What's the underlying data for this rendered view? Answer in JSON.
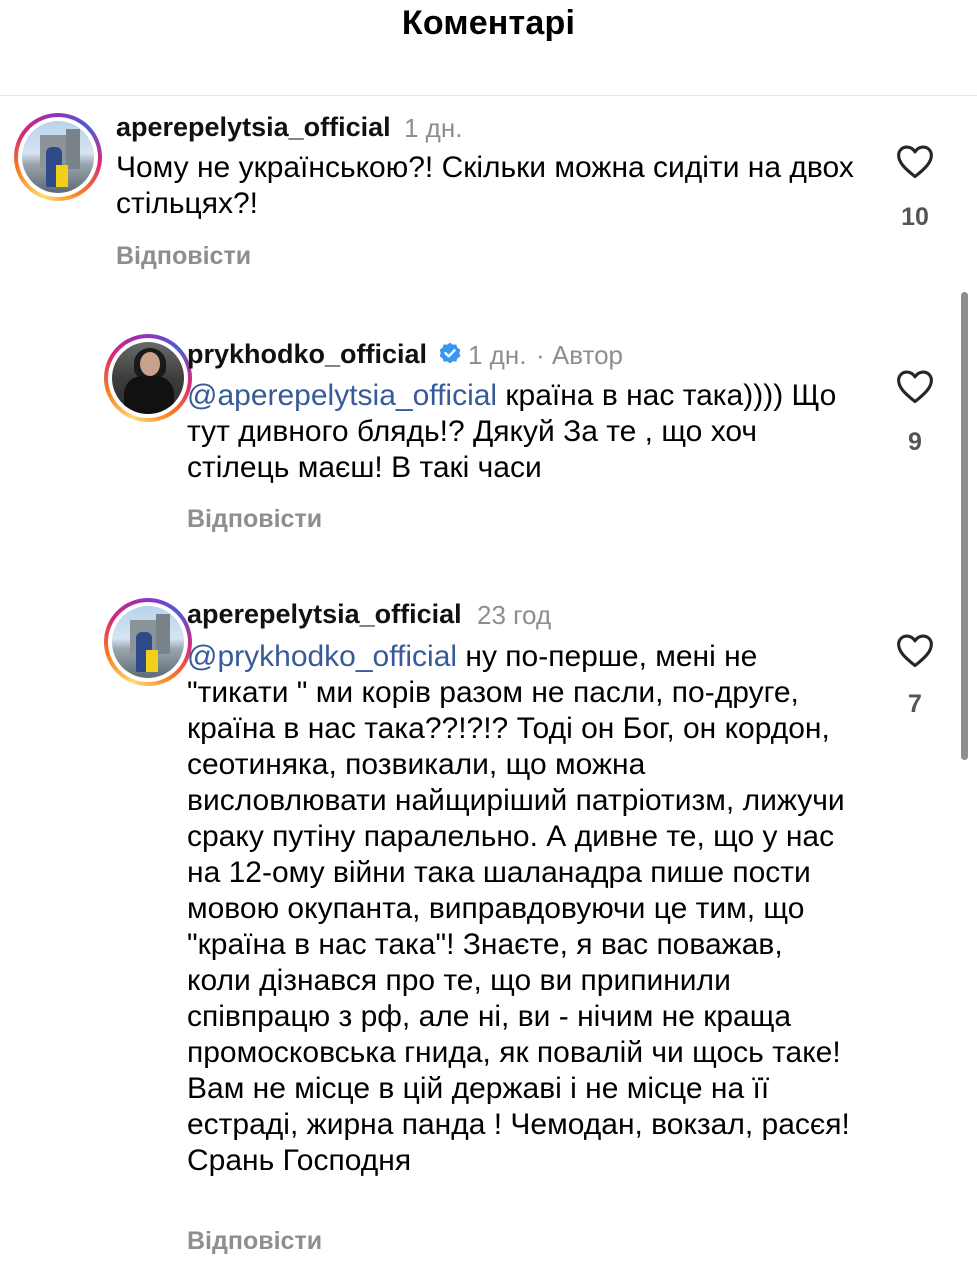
{
  "header": {
    "title": "Коментарі"
  },
  "comments": [
    {
      "username": "aperepelytsia_official",
      "time": "1 дн.",
      "text": "Чому не українською?! Скільки можна сидіти на двох стільцях?!",
      "likes": "10",
      "reply_label": "Відповісти"
    },
    {
      "username": "prykhodko_official",
      "time": "1 дн.",
      "author_label": "· Автор",
      "mention": "@aperepelytsia_official",
      "text": " країна в нас така)))) Що тут дивного блядь!? Дякуй За те , що хоч стілець маєш! В такі часи",
      "likes": "9",
      "reply_label": "Відповісти"
    },
    {
      "username": "aperepelytsia_official",
      "time": "23 год",
      "mention": "@prykhodko_official",
      "text": " ну по-перше, мені не \"тикати \" ми корів разом не пасли, по-друге, країна в нас така??!?!? Тоді он Бог, он кордон, сеотиняка, позвикали, що можна висловлювати найщиріший патріотизм, лижучи сраку путіну паралельно. А дивне те, що у нас на 12-ому війни така шаланадра пише пости мовою окупанта, виправдовуючи це тим, що \"країна в нас така\"! Знаєте, я вас поважав, коли дізнався про те, що ви припинили співпрацю з рф, але ні, ви - нічим не краща промосковська гнида, як повалій чи щось таке!  Вам не місце в цій державі і не місце на її естраді, жирна панда !  Чемодан, вокзал, расєя! Срань Господня",
      "likes": "7",
      "reply_label": "Відповісти"
    }
  ],
  "icons": {
    "like": "heart-outline-icon",
    "verified": "verified-badge-icon"
  },
  "colors": {
    "mention": "#375a9a",
    "verified": "#3897f0",
    "meta": "#8e8e8e"
  }
}
